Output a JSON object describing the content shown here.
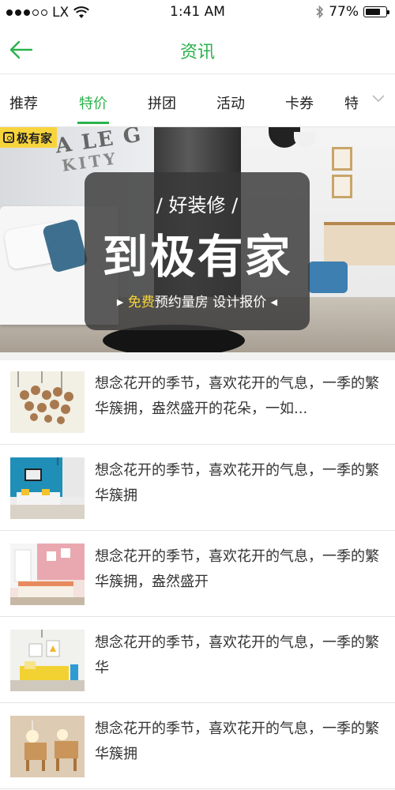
{
  "status_bar": {
    "carrier": "LX",
    "time": "1:41 AM",
    "battery": "77%",
    "battery_level": 0.77
  },
  "nav": {
    "title": "资讯",
    "back_icon": "back-arrow-icon"
  },
  "tabs": {
    "items": [
      "推荐",
      "特价",
      "拼团",
      "活动",
      "卡券",
      "特"
    ],
    "active_index": 1,
    "more_icon": "chevron-down-icon"
  },
  "banner": {
    "logo_text": "极有家",
    "subtitle": "好装修",
    "headline": "到极有家",
    "highlight": "免费",
    "tagline": "预约量房 设计报价"
  },
  "news": [
    {
      "text": "想念花开的季节，喜欢花开的气息，一季的繁华簇拥，盎然盛开的花朵，一如..."
    },
    {
      "text": "想念花开的季节，喜欢花开的气息，一季的繁华簇拥"
    },
    {
      "text": "想念花开的季节，喜欢花开的气息，一季的繁华簇拥，盎然盛开"
    },
    {
      "text": "想念花开的季节，喜欢花开的气息，一季的繁华"
    },
    {
      "text": "想念花开的季节，喜欢花开的气息，一季的繁华簇拥"
    }
  ],
  "colors": {
    "accent": "#2bb24c",
    "banner_tag": "#f7d43c"
  }
}
